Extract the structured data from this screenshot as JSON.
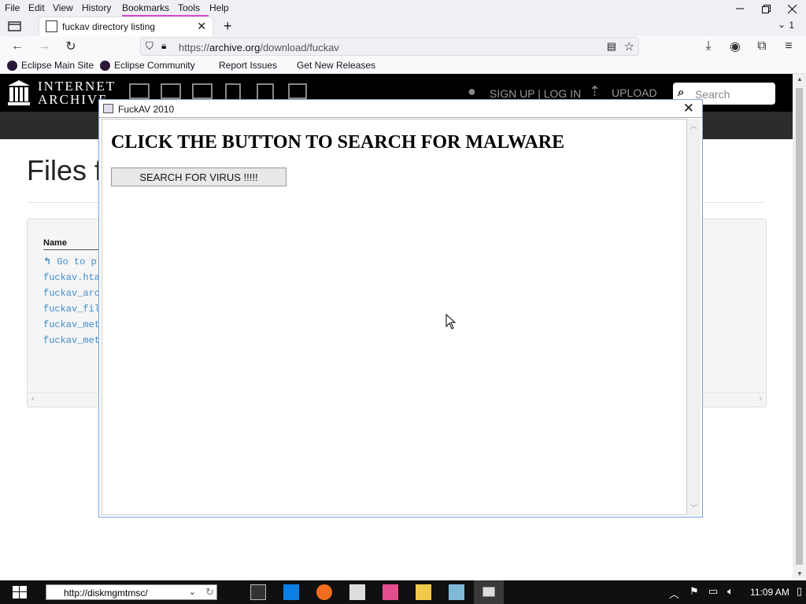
{
  "menubar": {
    "items": [
      "File",
      "Edit",
      "View",
      "History",
      "Bookmarks",
      "Tools",
      "Help"
    ]
  },
  "tab": {
    "title": "fuckav directory listing",
    "count": "1"
  },
  "urlbar": {
    "prefix": "https://",
    "host": "archive.org",
    "path": "/download/fuckav"
  },
  "bookmarks": [
    "Eclipse Main Site",
    "Eclipse Community",
    "Report Issues",
    "Get New Releases"
  ],
  "ia": {
    "logo_line1": "INTERNET",
    "logo_line2": "ARCHIVE",
    "signup": "SIGN UP | LOG IN",
    "upload": "UPLOAD",
    "search_placeholder": "Search",
    "heading": "Files f",
    "column_name": "Name",
    "files": [
      "Go to p",
      "fuckav.hta",
      "fuckav_arc",
      "fuckav_fil",
      "fuckav_met",
      "fuckav_met"
    ]
  },
  "popup": {
    "title": "FuckAV 2010",
    "heading": "CLICK THE BUTTON TO SEARCH FOR MALWARE",
    "button_label": "SEARCH FOR VIRUS !!!!!"
  },
  "taskbar": {
    "address": "http://diskmgmtmsc/",
    "time": "11:09 AM"
  },
  "colors": {
    "ia_header": "#000000",
    "link": "#428bca",
    "bookmarks_accent": "#d64ad6"
  }
}
